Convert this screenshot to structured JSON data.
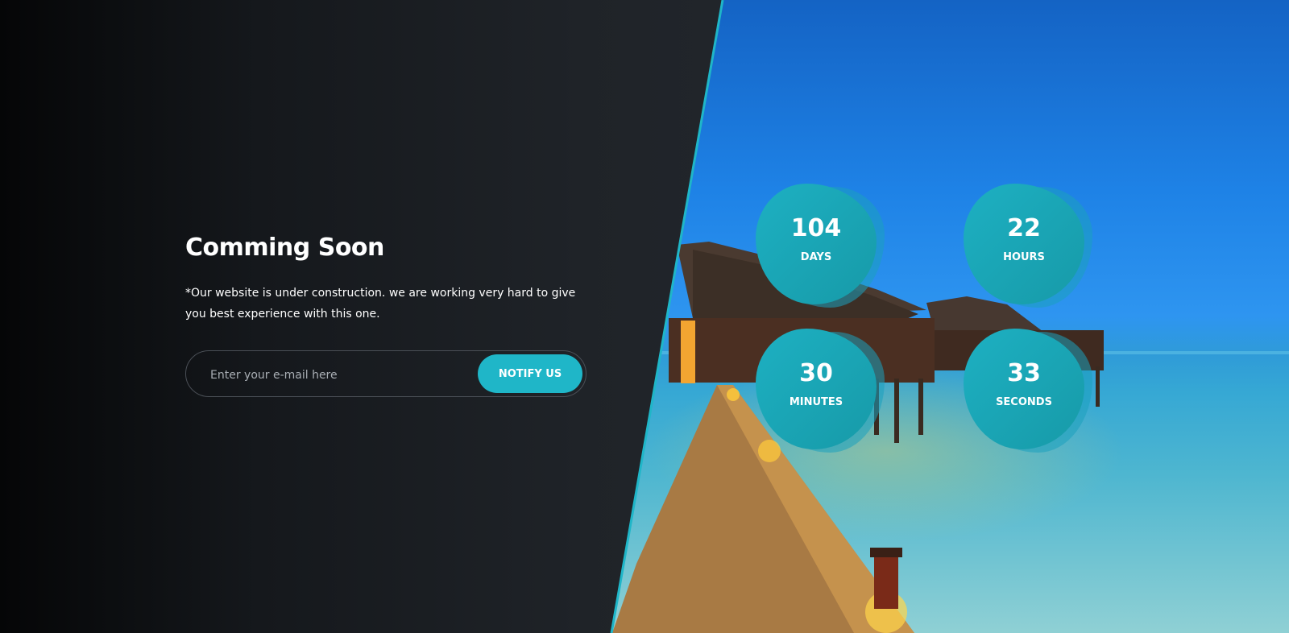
{
  "hero": {
    "title": "Comming Soon",
    "description": "*Our website is under construction. we are working very hard to give you best experience with this one."
  },
  "subscribe": {
    "placeholder": "Enter your e-mail here",
    "button_label": "NOTIFY US"
  },
  "countdown": [
    {
      "value": "104",
      "label": "DAYS"
    },
    {
      "value": "22",
      "label": "HOURS"
    },
    {
      "value": "30",
      "label": "MINUTES"
    },
    {
      "value": "33",
      "label": "SECONDS"
    }
  ],
  "colors": {
    "accent": "#1fb6c8",
    "dark_bg": "#24282e"
  }
}
